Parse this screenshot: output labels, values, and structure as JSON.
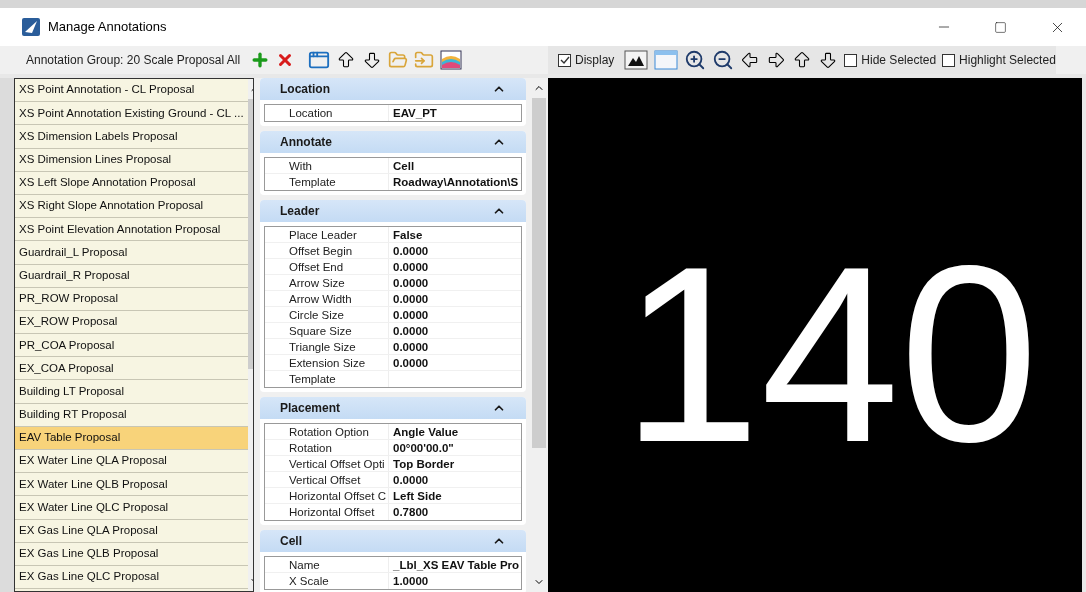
{
  "window": {
    "title": "Manage Annotations"
  },
  "toolbar": {
    "group_label": "Annotation Group: 20 Scale Proposal All"
  },
  "preview_toolbar": {
    "display": {
      "label": "Display",
      "checked": true
    },
    "hide_selected": {
      "label": "Hide Selected",
      "checked": false
    },
    "highlight_selected": {
      "label": "Highlight Selected",
      "checked": false
    }
  },
  "annotation_list": [
    {
      "label": "XS Point Annotation - CL Proposal",
      "selected": false
    },
    {
      "label": "XS Point Annotation Existing Ground - CL ...",
      "selected": false
    },
    {
      "label": "XS Dimension Labels Proposal",
      "selected": false
    },
    {
      "label": "XS Dimension Lines Proposal",
      "selected": false
    },
    {
      "label": "XS Left Slope Annotation Proposal",
      "selected": false
    },
    {
      "label": "XS Right Slope Annotation Proposal",
      "selected": false
    },
    {
      "label": "XS Point Elevation Annotation Proposal",
      "selected": false
    },
    {
      "label": "Guardrail_L Proposal",
      "selected": false
    },
    {
      "label": "Guardrail_R Proposal",
      "selected": false
    },
    {
      "label": "PR_ROW Proposal",
      "selected": false
    },
    {
      "label": "EX_ROW Proposal",
      "selected": false
    },
    {
      "label": "PR_COA Proposal",
      "selected": false
    },
    {
      "label": "EX_COA Proposal",
      "selected": false
    },
    {
      "label": "Building LT Proposal",
      "selected": false
    },
    {
      "label": "Building RT Proposal",
      "selected": false
    },
    {
      "label": "EAV Table Proposal",
      "selected": true
    },
    {
      "label": "EX Water Line QLA Proposal",
      "selected": false
    },
    {
      "label": "EX Water Line QLB Proposal",
      "selected": false
    },
    {
      "label": "EX Water Line QLC Proposal",
      "selected": false
    },
    {
      "label": "EX Gas Line QLA Proposal",
      "selected": false
    },
    {
      "label": "EX Gas Line QLB Proposal",
      "selected": false
    },
    {
      "label": "EX Gas Line QLC Proposal",
      "selected": false
    }
  ],
  "sections": [
    {
      "title": "Location",
      "expanded": true,
      "rows": [
        {
          "label": "Location",
          "value": "EAV_PT"
        }
      ]
    },
    {
      "title": "Annotate",
      "expanded": true,
      "rows": [
        {
          "label": "With",
          "value": "Cell"
        },
        {
          "label": "Template",
          "value": "Roadway\\Annotation\\S"
        }
      ]
    },
    {
      "title": "Leader",
      "expanded": true,
      "rows": [
        {
          "label": "Place Leader",
          "value": "False"
        },
        {
          "label": "Offset Begin",
          "value": "0.0000"
        },
        {
          "label": "Offset End",
          "value": "0.0000"
        },
        {
          "label": "Arrow Size",
          "value": "0.0000"
        },
        {
          "label": "Arrow Width",
          "value": "0.0000"
        },
        {
          "label": "Circle Size",
          "value": "0.0000"
        },
        {
          "label": "Square Size",
          "value": "0.0000"
        },
        {
          "label": "Triangle Size",
          "value": "0.0000"
        },
        {
          "label": "Extension Size",
          "value": "0.0000"
        },
        {
          "label": "Template"
        }
      ]
    },
    {
      "title": "Placement",
      "expanded": true,
      "rows": [
        {
          "label": "Rotation Option",
          "value": "Angle Value"
        },
        {
          "label": "Rotation",
          "value": "00°00'00.0\""
        },
        {
          "label": "Vertical Offset Opti",
          "value": "Top Border"
        },
        {
          "label": "Vertical Offset",
          "value": "0.0000"
        },
        {
          "label": "Horizontal Offset C",
          "value": "Left Side"
        },
        {
          "label": "Horizontal Offset",
          "value": "0.7800"
        }
      ]
    },
    {
      "title": "Cell",
      "expanded": true,
      "rows": [
        {
          "label": "Name",
          "value": "_Lbl_XS EAV Table Pro"
        },
        {
          "label": "X Scale",
          "value": "1.0000"
        }
      ]
    }
  ],
  "preview": {
    "text": "140"
  }
}
